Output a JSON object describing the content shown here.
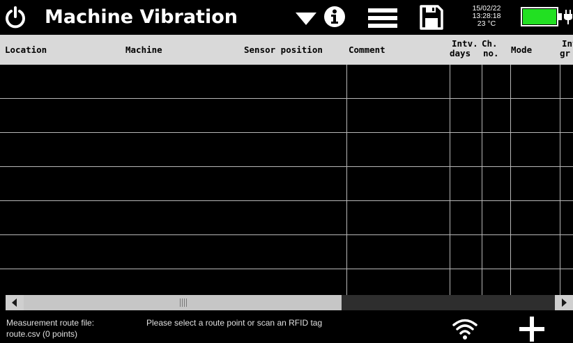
{
  "app": {
    "title": "Machine Vibration"
  },
  "status": {
    "date": "15/02/22",
    "time": "13:28:18",
    "temperature": "23 °C",
    "battery_level": 1.0,
    "battery_color": "#22e022"
  },
  "table": {
    "columns": [
      {
        "id": "location",
        "lines": [
          "Location"
        ]
      },
      {
        "id": "machine",
        "lines": [
          "Machine"
        ]
      },
      {
        "id": "sensor_position",
        "lines": [
          "Sensor position"
        ]
      },
      {
        "id": "comment",
        "lines": [
          "Comment"
        ]
      },
      {
        "id": "intv_days",
        "lines": [
          "Intv.",
          "days"
        ]
      },
      {
        "id": "ch_no",
        "lines": [
          "Ch.",
          "no."
        ]
      },
      {
        "id": "mode",
        "lines": [
          "Mode"
        ]
      },
      {
        "id": "int_gr",
        "lines": [
          "Int",
          "gr"
        ]
      }
    ],
    "rows": []
  },
  "footer": {
    "route_file_label": "Measurement route file:",
    "route_file_value": "route.csv (0 points)",
    "message": "Please select a route point or scan an RFID tag"
  },
  "icons": [
    "power-icon",
    "dropdown-icon",
    "info-icon",
    "menu-icon",
    "save-icon",
    "battery-icon",
    "plug-icon",
    "wifi-icon",
    "add-icon"
  ]
}
